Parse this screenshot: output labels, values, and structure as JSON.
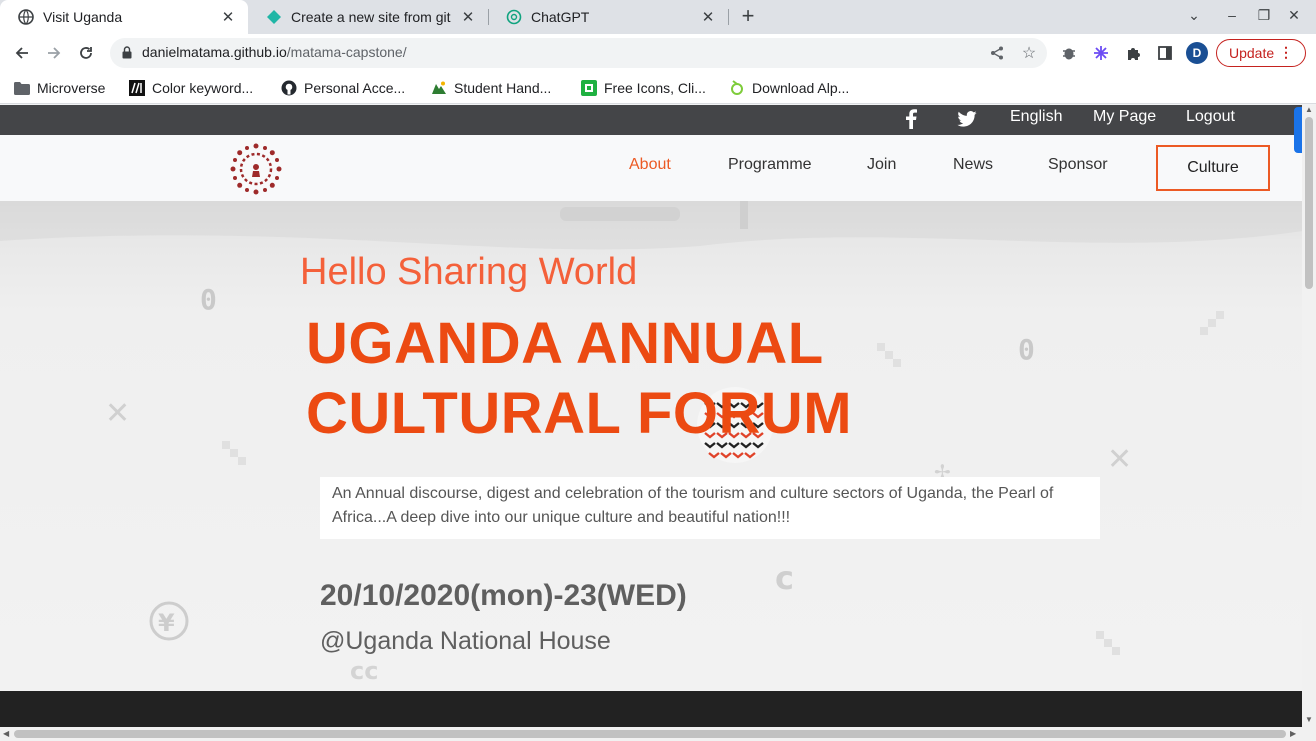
{
  "browser": {
    "tabs": [
      {
        "title": "Visit Uganda",
        "icon": "globe-icon",
        "active": true
      },
      {
        "title": "Create a new site from git",
        "icon": "netlify-icon",
        "active": false
      },
      {
        "title": "ChatGPT",
        "icon": "chatgpt-icon",
        "active": false
      }
    ],
    "address": {
      "host": "danielmatama.github.io",
      "path": "/matama-capstone/"
    },
    "profile_initial": "D",
    "update_label": "Update",
    "bookmarks": [
      {
        "label": "Microverse",
        "icon": "folder-icon"
      },
      {
        "label": "Color keyword...",
        "icon": "mdn-icon"
      },
      {
        "label": "Personal Acce...",
        "icon": "github-icon"
      },
      {
        "label": "Student Hand...",
        "icon": "student-icon"
      },
      {
        "label": "Free Icons, Cli...",
        "icon": "icons8-icon"
      },
      {
        "label": "Download Alp...",
        "icon": "alpine-icon"
      }
    ]
  },
  "page": {
    "topbar": {
      "language": "English",
      "my_page": "My Page",
      "logout": "Logout"
    },
    "nav": {
      "items": [
        "About",
        "Programme",
        "Join",
        "News",
        "Sponsor"
      ],
      "active": "About",
      "cta": "Culture"
    },
    "hero": {
      "greeting": "Hello Sharing World",
      "title_line1": "UGANDA ANNUAL",
      "title_line2": "CULTURAL FORUM",
      "description": "An Annual discourse, digest and celebration of the tourism and culture sectors of Uganda, the Pearl of Africa...A deep dive into our unique culture and beautiful nation!!!",
      "date": "20/10/2020(mon)-23(WED)",
      "venue": "@Uganda National House"
    },
    "colors": {
      "accent": "#ec4a12",
      "topbar": "#444548",
      "footer": "#222222"
    }
  }
}
